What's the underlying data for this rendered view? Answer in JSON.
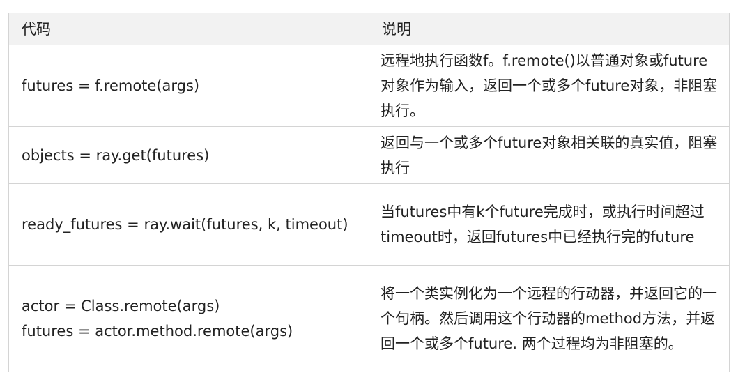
{
  "table": {
    "headers": [
      "代码",
      "说明"
    ],
    "rows": [
      {
        "code": [
          "futures = f.remote(args)"
        ],
        "desc": "远程地执行函数f。f.remote()以普通对象或future对象作为输入，返回一个或多个future对象，非阻塞执行。"
      },
      {
        "code": [
          "objects = ray.get(futures)"
        ],
        "desc": "返回与一个或多个future对象相关联的真实值，阻塞执行"
      },
      {
        "code": [
          "ready_futures = ray.wait(futures, k, timeout)"
        ],
        "desc": "当futures中有k个future完成时，或执行时间超过timeout时，返回futures中已经执行完的future"
      },
      {
        "code": [
          "actor = Class.remote(args)",
          "futures = actor.method.remote(args)"
        ],
        "desc": "将一个类实例化为一个远程的行动器，并返回它的一个句柄。然后调用这个行动器的method方法，并返回一个或多个future. 两个过程均为非阻塞的。"
      }
    ]
  }
}
